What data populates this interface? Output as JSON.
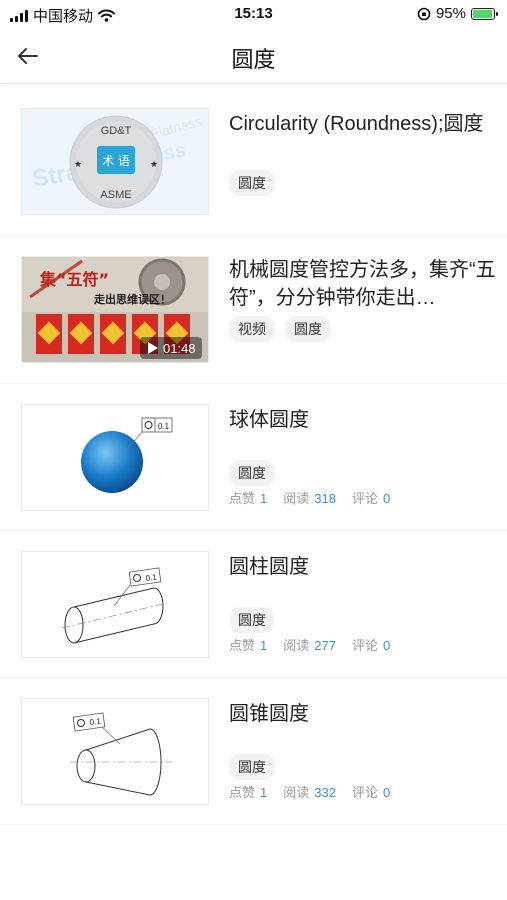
{
  "status_bar": {
    "carrier": "中国移动",
    "time": "15:13",
    "battery": "95%"
  },
  "header": {
    "title": "圆度"
  },
  "items": [
    {
      "title": "Circularity (Roundness);圆度",
      "tags": [
        "圆度"
      ],
      "thumb_text": {
        "top": "GD&T",
        "center": "术 语",
        "bottom": "ASME"
      }
    },
    {
      "title": "机械圆度管控方法多，集齐“五符”，分分钟带你走出…",
      "tags": [
        "视频",
        "圆度"
      ],
      "thumb_text": {
        "banner": "集“五符”",
        "subtitle": "走出思维误区！",
        "duration": "01:48"
      }
    },
    {
      "title": "球体圆度",
      "tags": [
        "圆度"
      ],
      "thumb_text": {
        "tolerance": "0.1"
      },
      "stats": {
        "likes_label": "点赞",
        "likes": "1",
        "reads_label": "阅读",
        "reads": "318",
        "comments_label": "评论",
        "comments": "0"
      }
    },
    {
      "title": "圆柱圆度",
      "tags": [
        "圆度"
      ],
      "thumb_text": {
        "tolerance": "0.1"
      },
      "stats": {
        "likes_label": "点赞",
        "likes": "1",
        "reads_label": "阅读",
        "reads": "277",
        "comments_label": "评论",
        "comments": "0"
      }
    },
    {
      "title": "圆锥圆度",
      "tags": [
        "圆度"
      ],
      "thumb_text": {
        "tolerance": "0.1"
      },
      "stats": {
        "likes_label": "点赞",
        "likes": "1",
        "reads_label": "阅读",
        "reads": "332",
        "comments_label": "评论",
        "comments": "0"
      }
    }
  ]
}
